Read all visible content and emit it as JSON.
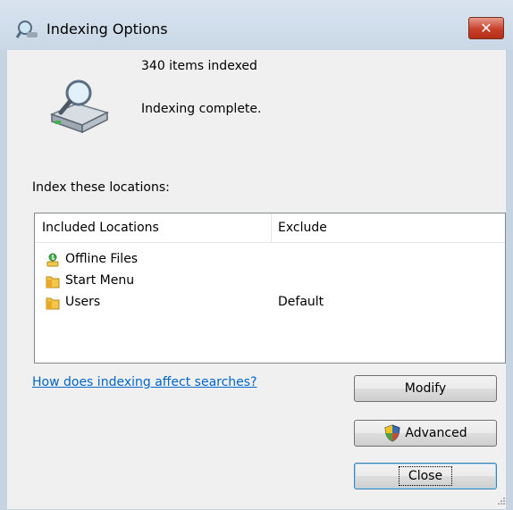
{
  "window": {
    "title": "Indexing Options"
  },
  "status": {
    "items_indexed": "340 items indexed",
    "state": "Indexing complete."
  },
  "locations": {
    "label": "Index these locations:",
    "columns": [
      "Included Locations",
      "Exclude"
    ],
    "rows": [
      {
        "name": "Offline Files",
        "exclude": "",
        "icon": "offline-files-icon"
      },
      {
        "name": "Start Menu",
        "exclude": "",
        "icon": "folder-icon"
      },
      {
        "name": "Users",
        "exclude": "Default",
        "icon": "folder-icon"
      }
    ]
  },
  "help_link": "How does indexing affect searches?",
  "buttons": {
    "modify": "Modify",
    "advanced": "Advanced",
    "close": "Close"
  },
  "colors": {
    "link": "#0066cc",
    "close_button": "#c8402a",
    "titlebar": "#c9d7e6"
  }
}
